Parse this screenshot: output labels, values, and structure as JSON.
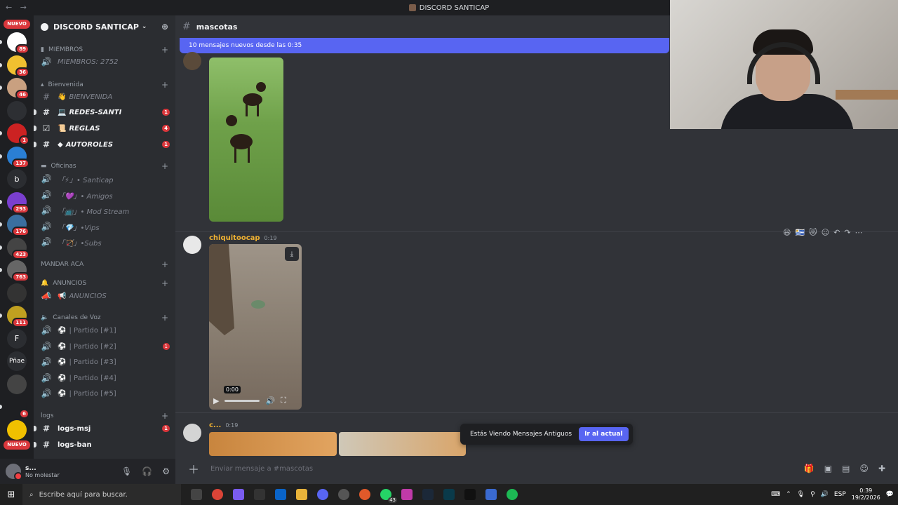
{
  "window": {
    "title": "DISCORD SANTICAP",
    "nav": "← →"
  },
  "servers": {
    "nuevo_top": "NUEVO",
    "nuevo_bottom": "NUEVO",
    "items": [
      {
        "letter": "",
        "color": "#ffffff",
        "badge": "89"
      },
      {
        "letter": "",
        "color": "#f0c030",
        "badge": "36"
      },
      {
        "letter": "",
        "color": "#c9a080",
        "badge": "46"
      },
      {
        "letter": "",
        "color": "#2d2f33",
        "badge": ""
      },
      {
        "letter": "",
        "color": "#cc2222",
        "badge": "1"
      },
      {
        "letter": "",
        "color": "#2a7fd4",
        "badge": "137"
      },
      {
        "letter": "b",
        "color": "#2b2d31",
        "badge": ""
      },
      {
        "letter": "",
        "color": "#7a3fcf",
        "badge": "293"
      },
      {
        "letter": "",
        "color": "#3a6fa0",
        "badge": "176"
      },
      {
        "letter": "",
        "color": "#444",
        "badge": "423"
      },
      {
        "letter": "",
        "color": "#666",
        "badge": "763"
      },
      {
        "letter": "",
        "color": "#333",
        "badge": ""
      },
      {
        "letter": "",
        "color": "#c0a020",
        "badge": "111"
      },
      {
        "letter": "F",
        "color": "#2b2d31",
        "badge": ""
      },
      {
        "letter": "Pñae",
        "color": "#2b2d31",
        "badge": ""
      },
      {
        "letter": "",
        "color": "#444",
        "badge": ""
      },
      {
        "letter": "",
        "color": "#1e1f22",
        "badge": "6"
      },
      {
        "letter": "",
        "color": "#f0c000",
        "badge": ""
      }
    ]
  },
  "guild": {
    "name": "DISCORD SANTICAP"
  },
  "sidebar": {
    "miembros_cat": "MIEMBROS",
    "miembros_count": "MIEMBROS: 2752",
    "bienvenida_cat": "Bienvenida",
    "bienvenida": "BIENVENIDA",
    "redes": "REDES-SANTI",
    "redes_count": "1",
    "reglas": "REGLAS",
    "reglas_count": "4",
    "autoroles": "AUTOROLES",
    "autoroles_count": "1",
    "oficinas_cat": "Oficinas",
    "oficinas": [
      "「⚡」• Santicap",
      "「💜」• Amigos",
      "「📺」• Mod Stream",
      "「💎」•Vips",
      "「🏹」•Subs"
    ],
    "mandar_cat": "MANDAR ACA",
    "anuncios_cat": "ANUNCIOS",
    "anuncios": "ANUNCIOS",
    "voz_cat": "Canales de Voz",
    "partidos": [
      "| Partido [#1]",
      "| Partido [#2]",
      "| Partido [#3]",
      "| Partido [#4]",
      "| Partido [#5]"
    ],
    "partido2_count": "1",
    "logs_cat": "logs",
    "logs_msj": "logs-msj",
    "logs_msj_count": "1",
    "logs_ban": "logs-ban"
  },
  "user": {
    "name": "s...",
    "status": "No molestar"
  },
  "channel": {
    "name": "mascotas"
  },
  "new_messages": "10 mensajes nuevos desde las 0:35",
  "messages": {
    "m2_author": "chiquitoocap",
    "m2_time": "0:19",
    "video_time": "0:00",
    "m3_author": "c...",
    "m3_time": "0:19"
  },
  "toast": {
    "text": "Estás Viendo Mensajes Antiguos",
    "button": "Ir al actual"
  },
  "composer": {
    "placeholder": "Enviar mensaje a #mascotas"
  },
  "taskbar": {
    "search": "Escribe aquí para buscar.",
    "whatsapp_badge": "43",
    "lang": "ESP",
    "time": "0:39",
    "date": "19/2/2026"
  }
}
